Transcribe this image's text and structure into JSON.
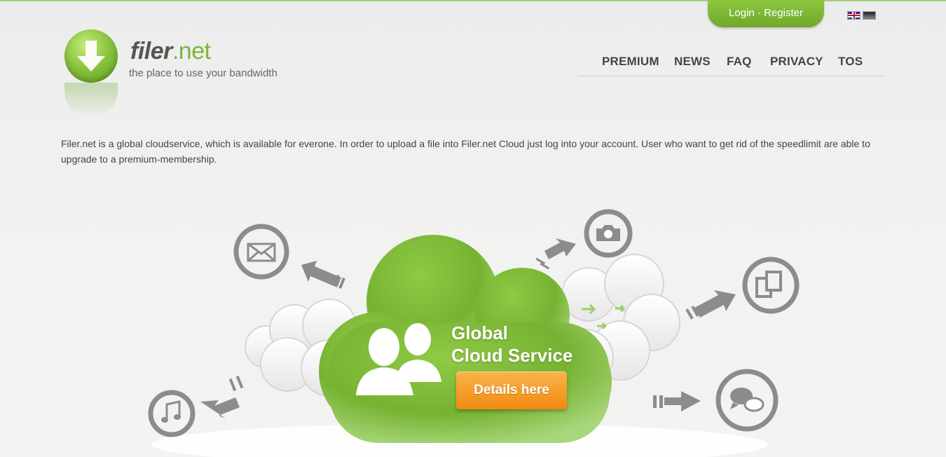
{
  "header": {
    "login_label": "Login",
    "separator": " · ",
    "register_label": "Register"
  },
  "logo": {
    "name_part1": "filer",
    "name_part2": ".net",
    "tagline": "the place to use your bandwidth"
  },
  "nav": {
    "items": [
      {
        "label": "PREMIUM"
      },
      {
        "label": "NEWS"
      },
      {
        "label": "FAQ"
      },
      {
        "label": "PRIVACY"
      },
      {
        "label": "TOS"
      }
    ]
  },
  "intro": {
    "text": "Filer.net is a global cloudservice, which is available for everone. In order to upload a file into Filer.net Cloud just log into your account. User who want to get rid of the speedlimit are able to upgrade to a premium-membership."
  },
  "hero": {
    "headline_line1": "Global",
    "headline_line2": "Cloud Service",
    "cta_label": "Details here"
  },
  "colors": {
    "brand_green": "#7cb53a",
    "cta_orange": "#f5a02a",
    "icon_gray": "#8a8a8a"
  }
}
